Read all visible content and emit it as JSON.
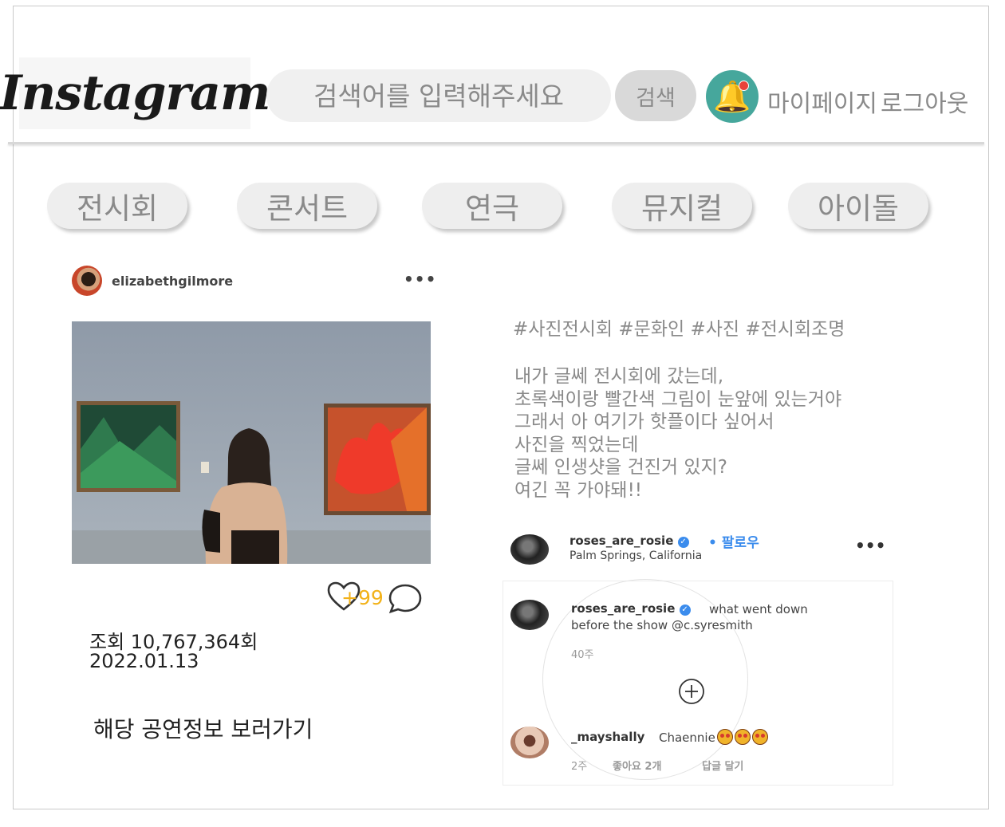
{
  "header": {
    "logo": "Instagram",
    "search_placeholder": "검색어를 입력해주세요",
    "search_button": "검색",
    "notification_badge": "1",
    "mypage_link": "마이페이지",
    "logout_link": "로그아웃"
  },
  "categories": [
    {
      "label": "전시회"
    },
    {
      "label": "콘서트"
    },
    {
      "label": "연극"
    },
    {
      "label": "뮤지컬"
    },
    {
      "label": "아이돌"
    }
  ],
  "post": {
    "username": "elizabethgilmore",
    "like_count": "+99",
    "views": "조회 10,767,364회",
    "date": "2022.01.13",
    "performance_link": "해당 공연정보 보러가기",
    "hashtags": "#사진전시회 #문화인 #사진 #전시회조명",
    "caption_lines": [
      "내가 글쎄 전시회에 갔는데,",
      "초록색이랑 빨간색 그림이 눈앞에 있는거야",
      "그래서 아 여기가 핫플이다 싶어서",
      "사진을 찍었는데",
      "글쎄 인생샷을 건진거 있지?",
      "여긴 꼭 가야돼!!"
    ]
  },
  "comments": {
    "author": {
      "name": "roses_are_rosie",
      "follow": "• 팔로우",
      "location": "Palm Springs, California"
    },
    "main_comment": {
      "name": "roses_are_rosie",
      "text_line1": "what went down",
      "text_line2": "before the show @c.syresmith",
      "time": "40주"
    },
    "reply": {
      "name": "_mayshally",
      "text": "Chaennie",
      "time": "2주",
      "likes": "좋아요 2개",
      "reply_action": "답글 달기"
    }
  },
  "colors": {
    "accent_blue": "#3b8ced",
    "bell_bg": "#46a79c",
    "like_count": "#f2b21a",
    "muted_text": "#8a8a8a"
  }
}
